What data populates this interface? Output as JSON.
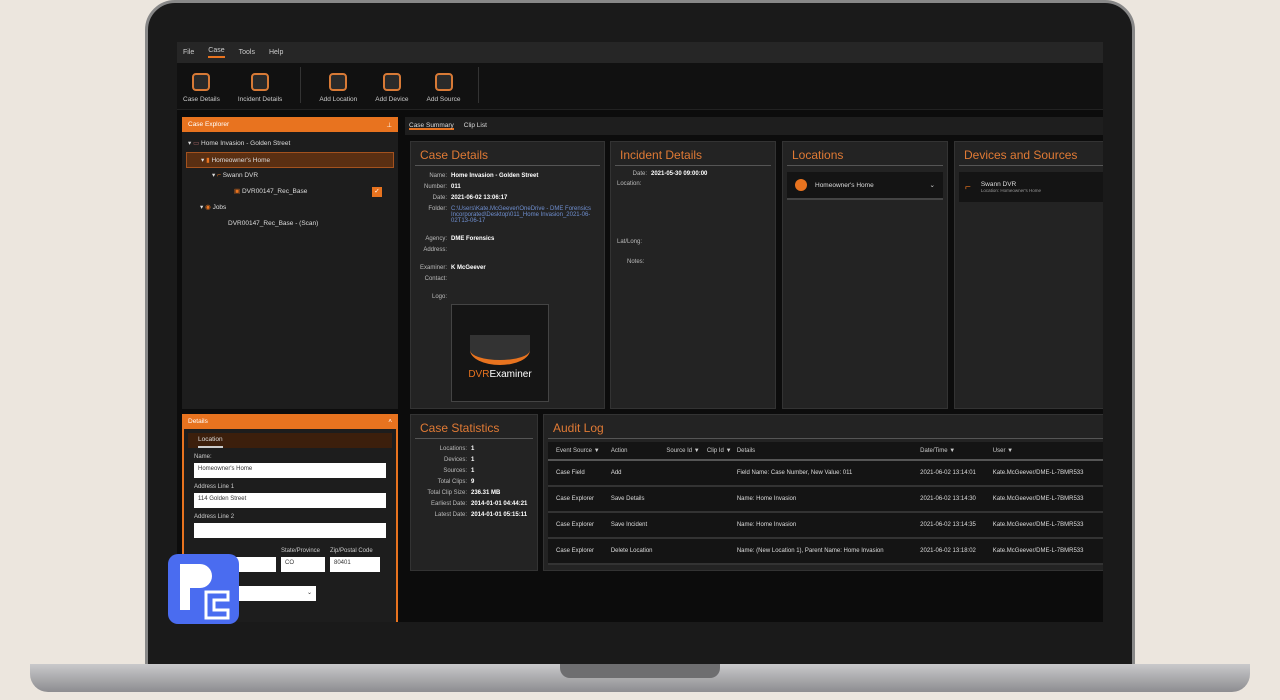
{
  "menu": [
    "File",
    "Case",
    "Tools",
    "Help"
  ],
  "ribbon": [
    "Case Details",
    "Incident Details",
    "Add Location",
    "Add Device",
    "Add Source"
  ],
  "explorer": {
    "title": "Case Explorer",
    "case": "Home Invasion - Golden Street",
    "location": "Homeowner's Home",
    "device": "Swann DVR",
    "source": "DVR00147_Rec_Base",
    "jobs": "Jobs",
    "job": "DVR00147_Rec_Base - (Scan)"
  },
  "details": {
    "title": "Details",
    "tab": "Location",
    "name_label": "Name:",
    "name": "Homeowner's Home",
    "addr1_label": "Address Line 1",
    "addr1": "114 Golden Street",
    "addr2_label": "Address Line 2",
    "addr2": "",
    "state_label": "State/Province",
    "state": "CO",
    "zip_label": "Zip/Postal Code",
    "zip": "80401"
  },
  "tabs": [
    "Case Summary",
    "Clip List"
  ],
  "case_details": {
    "title": "Case Details",
    "rows": [
      [
        "Name:",
        "Home Invasion - Golden Street"
      ],
      [
        "Number:",
        "011"
      ],
      [
        "Date:",
        "2021-06-02 13:06:17"
      ],
      [
        "Folder:",
        "C:\\Users\\Kate.McGeever\\OneDrive - DME Forensics Incorporated\\Desktop\\011_Home Invasion_2021-06-02T13-06-17"
      ],
      [
        "Agency:",
        "DME Forensics"
      ],
      [
        "Address:",
        ""
      ],
      [
        "Examiner:",
        "K McGeever"
      ],
      [
        "Contact:",
        ""
      ],
      [
        "Logo:",
        ""
      ]
    ],
    "logo_text": "DVR Examiner"
  },
  "incident": {
    "title": "Incident Details",
    "date_label": "Date:",
    "date": "2021-05-30 09:00:00",
    "location_label": "Location:",
    "latlong_label": "Lat/Long:",
    "notes_label": "Notes:"
  },
  "locations": {
    "title": "Locations",
    "item": "Homeowner's Home"
  },
  "devices": {
    "title": "Devices and Sources",
    "name": "Swann DVR",
    "sub": "Location: Homeowner's Home"
  },
  "stats": {
    "title": "Case Statistics",
    "rows": [
      [
        "Locations:",
        "1"
      ],
      [
        "Devices:",
        "1"
      ],
      [
        "Sources:",
        "1"
      ],
      [
        "Total Clips:",
        "9"
      ],
      [
        "Total Clip Size:",
        "236.31 MB"
      ],
      [
        "Earliest Date:",
        "2014-01-01 04:44:21"
      ],
      [
        "Latest Date:",
        "2014-01-01 05:15:11"
      ]
    ]
  },
  "audit": {
    "title": "Audit Log",
    "headers": [
      "Event Source",
      "Action",
      "Source Id",
      "Clip Id",
      "Details",
      "Date/Time",
      "User"
    ],
    "rows": [
      [
        "Case Field",
        "Add",
        "",
        "",
        "Field Name: Case Number, New Value: 011",
        "2021-06-02 13:14:01",
        "Kate.McGeever/DME-L-7BMR533"
      ],
      [
        "Case Explorer",
        "Save Details",
        "",
        "",
        "Name: Home Invasion",
        "2021-06-02 13:14:30",
        "Kate.McGeever/DME-L-7BMR533"
      ],
      [
        "Case Explorer",
        "Save Incident",
        "",
        "",
        "Name: Home Invasion",
        "2021-06-02 13:14:35",
        "Kate.McGeever/DME-L-7BMR533"
      ],
      [
        "Case Explorer",
        "Delete Location",
        "",
        "",
        "Name: (New Location 1), Parent Name: Home Invasion",
        "2021-06-02 13:18:02",
        "Kate.McGeever/DME-L-7BMR533"
      ]
    ]
  }
}
